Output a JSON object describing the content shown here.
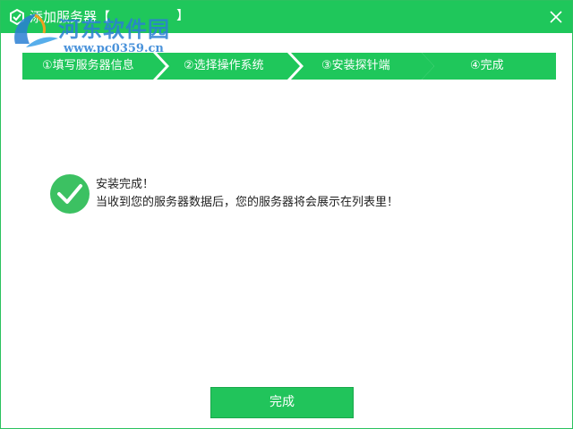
{
  "window": {
    "title": "添加服务器【",
    "title_hidden": "】"
  },
  "watermark": {
    "name": "河东软件园",
    "url": "www.pc0359.cn"
  },
  "steps": [
    {
      "label": "①填写服务器信息"
    },
    {
      "label": "②选择操作系统"
    },
    {
      "label": "③安装探针端"
    },
    {
      "label": "④完成"
    }
  ],
  "result": {
    "title": "安装完成！",
    "description": "当收到您的服务器数据后，您的服务器将会展示在列表里！"
  },
  "footer": {
    "finish_label": "完成"
  },
  "colors": {
    "accent": "#1fc75b",
    "step": "#1fc75b"
  }
}
